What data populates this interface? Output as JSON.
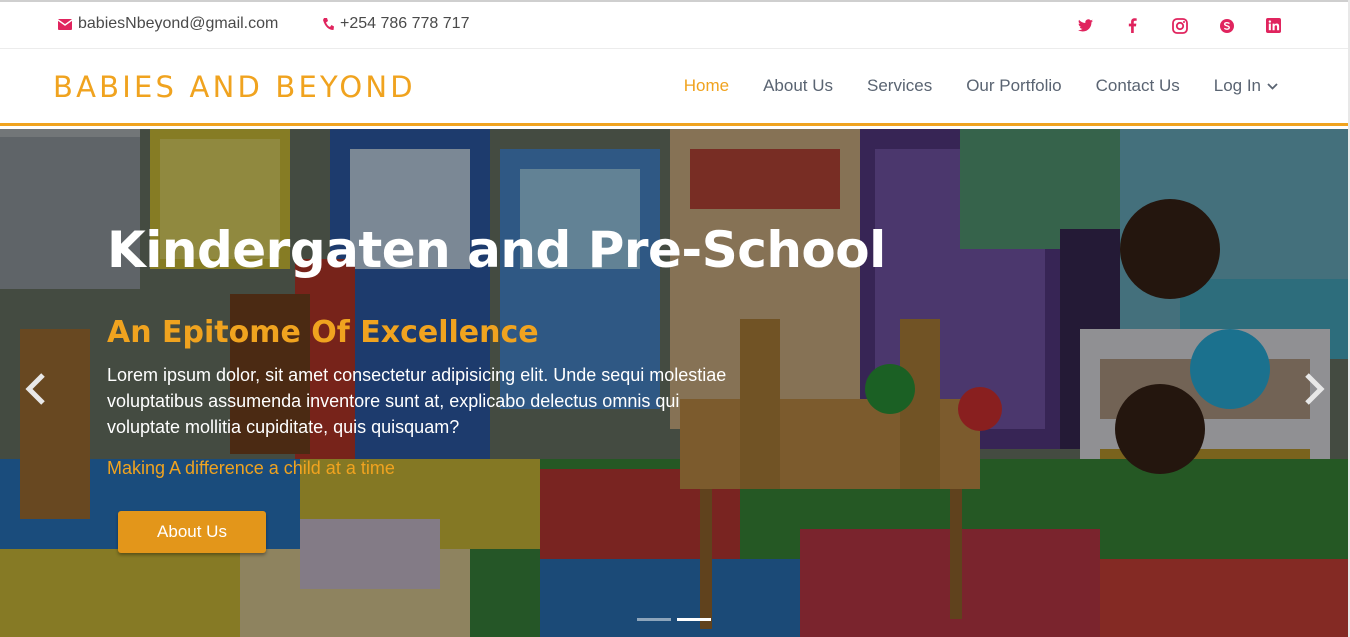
{
  "topbar": {
    "email": "babiesNbeyond@gmail.com",
    "phone": "+254 786 778 717",
    "social_icons": [
      "twitter-icon",
      "facebook-icon",
      "instagram-icon",
      "skype-icon",
      "linkedin-icon"
    ]
  },
  "navbar": {
    "brand": "BABIES AND BEYOND",
    "items": [
      {
        "label": "Home",
        "active": true
      },
      {
        "label": "About Us",
        "active": false
      },
      {
        "label": "Services",
        "active": false
      },
      {
        "label": "Our Portfolio",
        "active": false
      },
      {
        "label": "Contact Us",
        "active": false
      },
      {
        "label": "Log In",
        "active": false
      }
    ]
  },
  "hero": {
    "title": "Kindergaten and Pre-School",
    "subtitle": "An Epitome Of Excellence",
    "text": "Lorem ipsum dolor, sit amet consectetur adipisicing elit. Unde sequi molestiae voluptatibus assumenda inventore sunt at, explicabo delectus omnis qui voluptate mollitia cupiditate, quis quisquam?",
    "tagline": "Making A difference a child at a time",
    "button": "About Us",
    "slides": 2,
    "active_slide": 2
  },
  "colors": {
    "accent": "#f0a31f",
    "button": "#e3961a",
    "social": "#e0245e",
    "nav_text": "#5a6472"
  }
}
